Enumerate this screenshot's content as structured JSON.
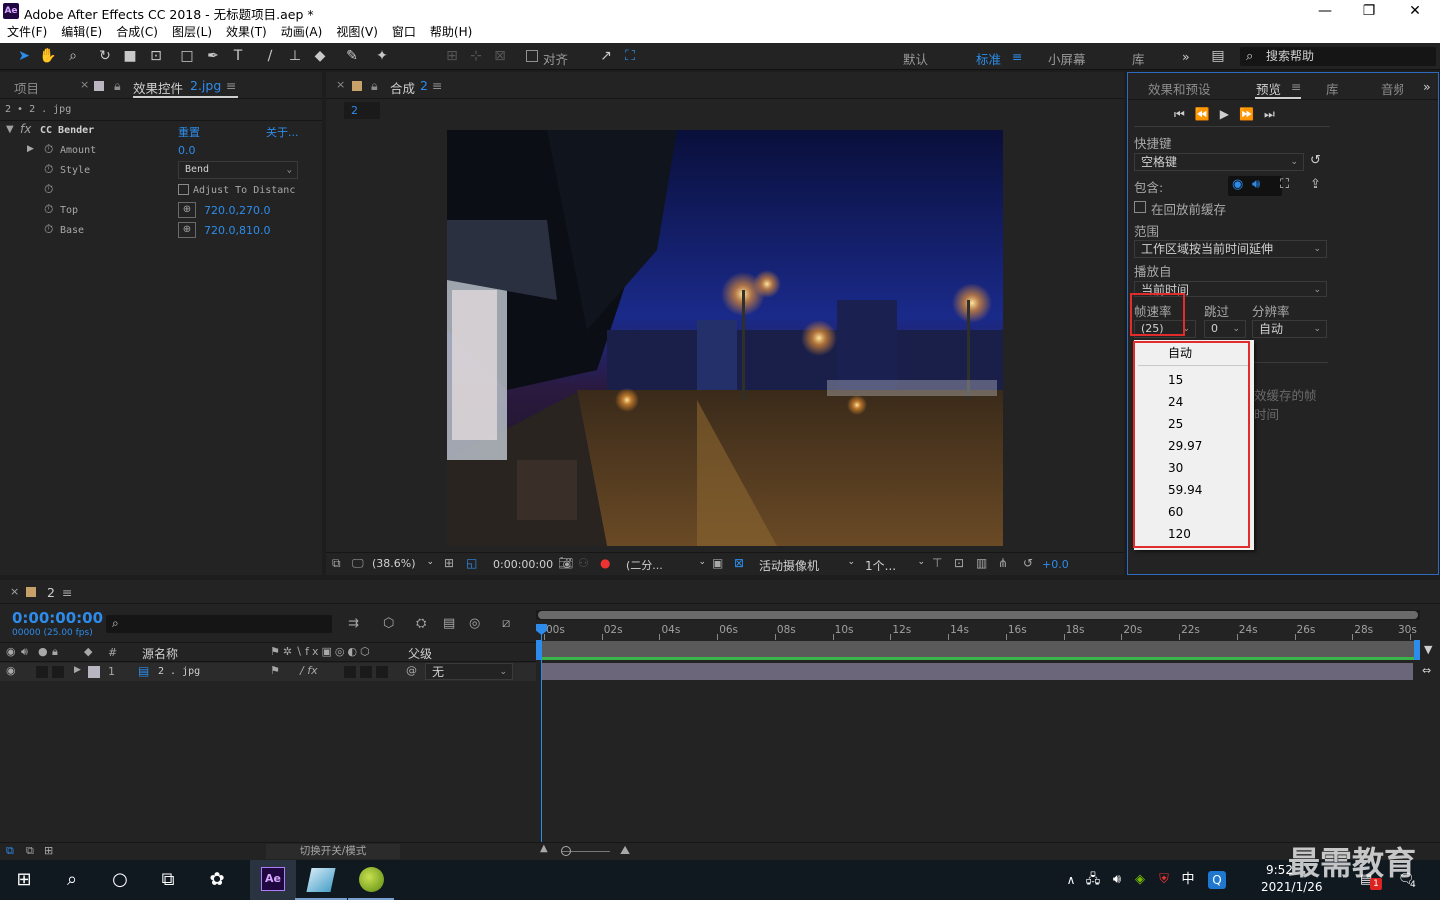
{
  "window": {
    "app_logo": "Ae",
    "title": "Adobe After Effects CC 2018 - 无标题项目.aep *",
    "minimize": "—",
    "maximize": "❐",
    "close": "✕"
  },
  "menu": [
    "文件(F)",
    "编辑(E)",
    "合成(C)",
    "图层(L)",
    "效果(T)",
    "动画(A)",
    "视图(V)",
    "窗口",
    "帮助(H)"
  ],
  "toolbar": {
    "align_label": "对齐",
    "workspaces": [
      "默认",
      "标准",
      "小屏幕",
      "库"
    ],
    "active_workspace": "标准",
    "more": "»",
    "search_placeholder": "搜索帮助"
  },
  "left_panel": {
    "tab_project": "项目",
    "tab_effects": "效果控件",
    "tab_effects_file": "2.jpg",
    "breadcrumb": "2 • 2 . jpg",
    "effect_name": "CC Bender",
    "reset": "重置",
    "about": "关于...",
    "props": [
      {
        "name": "Amount",
        "value": "0.0"
      },
      {
        "name": "Style",
        "value": "Bend"
      },
      {
        "name": "",
        "value": "Adjust To Distanc"
      },
      {
        "name": "Top",
        "value": "720.0,270.0"
      },
      {
        "name": "Base",
        "value": "720.0,810.0"
      }
    ]
  },
  "comp_panel": {
    "tab_label": "合成",
    "comp_name": "2",
    "sub_tab": "2",
    "zoom": "(38.6%)",
    "timecode": "0:00:00:00",
    "resolution": "(二分...",
    "camera": "活动摄像机",
    "views": "1个...",
    "exposure": "+0.0"
  },
  "preview_panel": {
    "tab_effects_presets": "效果和预设",
    "tab_preview": "预览",
    "tab_library": "库",
    "tab_audio": "音频",
    "shortcut_label": "快捷键",
    "shortcut_value": "空格键",
    "include_label": "包含:",
    "cache_label": "在回放前缓存",
    "range_label": "范围",
    "range_value": "工作区域按当前时间延伸",
    "play_from_label": "播放自",
    "play_from_value": "当前时间",
    "framerate_label": "帧速率",
    "skip_label": "跳过",
    "resolution_label": "分辨率",
    "framerate_value": "(25)",
    "skip_value": "0",
    "resolution_value": "自动",
    "hidden_text_1": "效缓存的帧",
    "hidden_text_2": "时间"
  },
  "fps_menu": {
    "items": [
      "自动",
      "15",
      "24",
      "25",
      "29.97",
      "30",
      "59.94",
      "60",
      "120"
    ]
  },
  "timeline": {
    "tab_label": "2",
    "timecode": "0:00:00:00",
    "frame_info": "00000 (25.00 fps)",
    "search_placeholder": "",
    "col_number": "#",
    "col_source": "源名称",
    "col_parent": "父级",
    "layer": {
      "index": "1",
      "name": "2 . jpg",
      "parent": "无"
    },
    "ruler": [
      "00s",
      "02s",
      "04s",
      "06s",
      "08s",
      "10s",
      "12s",
      "14s",
      "16s",
      "18s",
      "20s",
      "22s",
      "24s",
      "26s",
      "28s",
      "30s"
    ],
    "toggle_modes": "切换开关/模式"
  },
  "taskbar": {
    "time": "9:52",
    "date": "2021/1/26",
    "ime": "中",
    "badge": "1",
    "notif_count": "4"
  },
  "watermark": "最需教育",
  "colors": {
    "accent_blue": "#2d8ceb",
    "highlight_red": "#e22b2b",
    "timeline_green": "#39b54a",
    "layer_bar": "#6b6679"
  }
}
